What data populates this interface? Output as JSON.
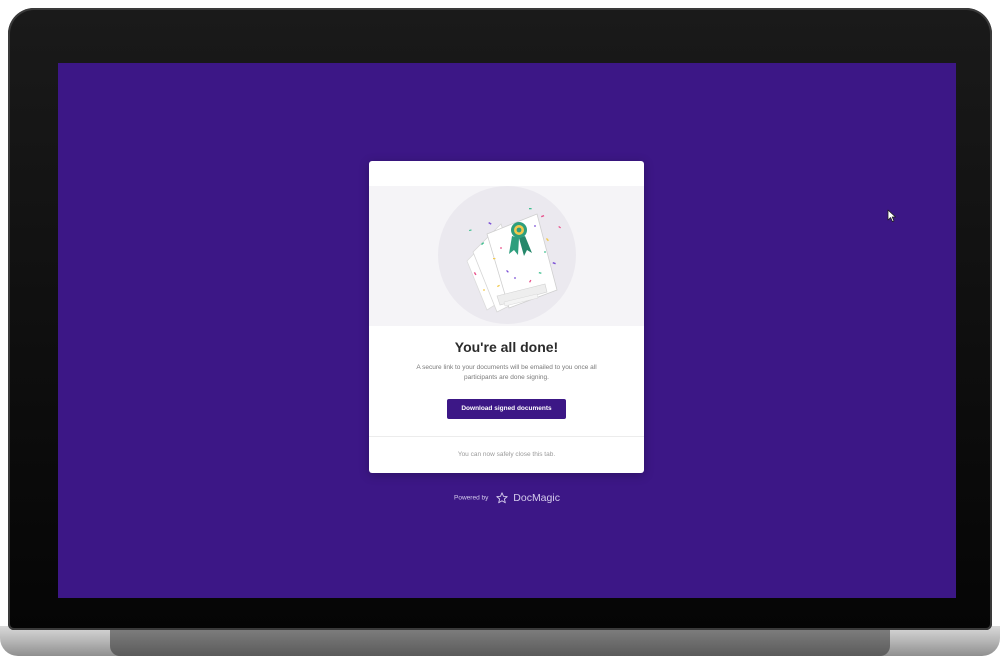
{
  "completion_card": {
    "title": "You're all done!",
    "message": "A secure link to your documents will be emailed to you once all participants are done signing.",
    "download_label": "Download signed documents",
    "footer_note": "You can now safely close this tab."
  },
  "powered_by": {
    "label": "Powered by",
    "brand": "DocMagic",
    "icon": "star-outline-icon"
  },
  "illustration": {
    "icon": "award-ribbon-documents-illustration"
  },
  "colors": {
    "background": "#3c1786",
    "card": "#ffffff",
    "button": "#3c1786",
    "ribbon": "#2e9e7d",
    "laptop_bezel": "#0b0b0b"
  }
}
